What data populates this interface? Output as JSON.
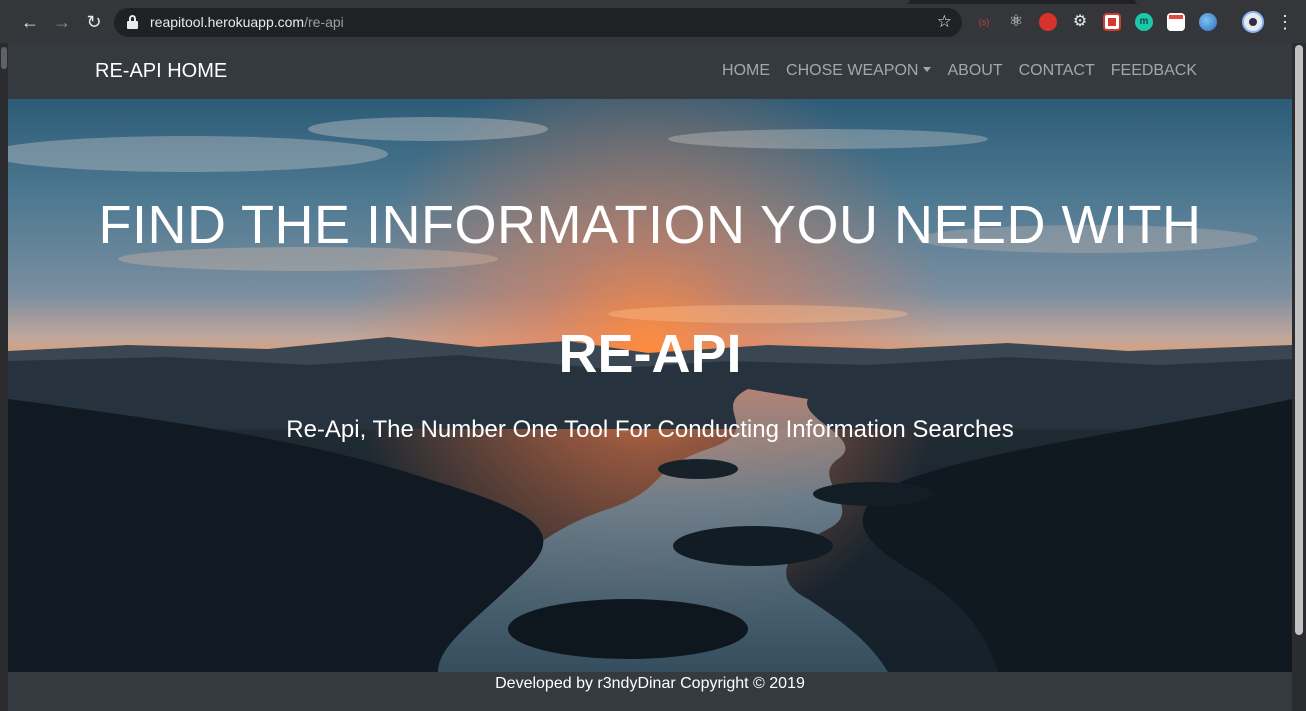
{
  "browser": {
    "url_host": "reapitool.herokuapp.com",
    "url_path": "/re-api",
    "icons": {
      "back": "arrow-left",
      "forward": "arrow-right",
      "reload": "reload",
      "lock": "lock",
      "bookmark": "star",
      "menu": "three-dots"
    },
    "extensions": [
      {
        "name": "extension-1",
        "label": "(s)"
      },
      {
        "name": "react-devtools",
        "label": "⚛"
      },
      {
        "name": "extension-3",
        "label": ""
      },
      {
        "name": "settings-extension",
        "label": "⚙"
      },
      {
        "name": "extension-5",
        "label": ""
      },
      {
        "name": "extension-6",
        "label": "m"
      },
      {
        "name": "extension-7",
        "label": ""
      },
      {
        "name": "extension-8",
        "label": ""
      }
    ]
  },
  "site": {
    "brand": "RE-API HOME",
    "nav": {
      "home": "HOME",
      "weapon": "CHOSE WEAPON",
      "about": "ABOUT",
      "contact": "CONTACT",
      "feedback": "FEEDBACK"
    },
    "hero": {
      "title": "FIND THE INFORMATION YOU NEED WITH",
      "brand": "RE-API",
      "subtitle": "Re-Api, The Number One Tool For Conducting Information Searches"
    },
    "footer": "Developed by r3ndyDinar Copyright © 2019"
  },
  "colors": {
    "navbar": "#343a40",
    "chrome": "#35363a",
    "text": "#ffffff"
  }
}
